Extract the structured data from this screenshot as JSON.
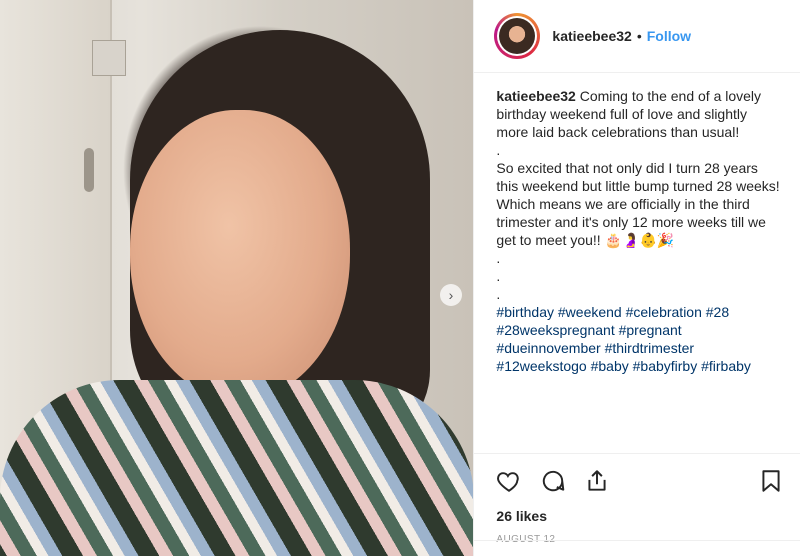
{
  "post": {
    "username": "katieebee32",
    "follow_label": "Follow",
    "separator": "•",
    "caption_lines": [
      "Coming to the end of a lovely birthday weekend full of love and slightly more laid back celebrations than usual!",
      ".",
      "So excited that not only did I turn 28 years this weekend but little bump turned 28 weeks! Which means we are officially in the third trimester and it's only 12 more weeks till we get to meet you!! 🎂🤰👶🎉",
      ".",
      ".",
      "."
    ],
    "hashtags": "#birthday #weekend #celebration #28 #28weekspregnant #pregnant #dueinnovember #thirdtrimester #12weekstogo #baby #babyfirby #firbaby",
    "likes": "26 likes",
    "date": "AUGUST 12"
  },
  "icons": {
    "like": "heart-icon",
    "comment": "comment-icon",
    "share": "share-icon",
    "save": "bookmark-icon",
    "next": "chevron-right-icon"
  },
  "colors": {
    "link": "#3897f0",
    "hashtag": "#003569",
    "muted": "#999999"
  }
}
